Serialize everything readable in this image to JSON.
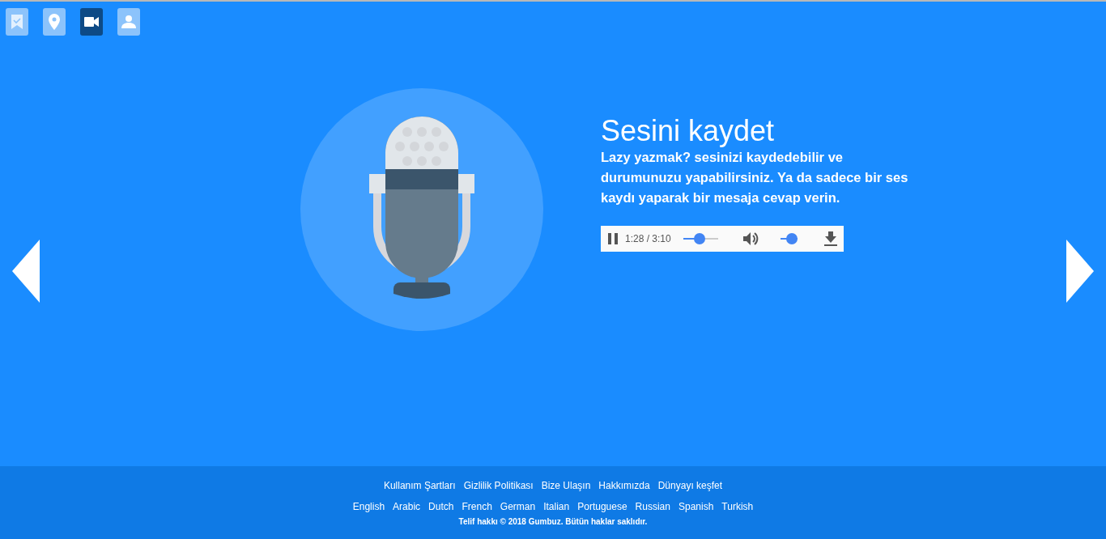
{
  "nav": [
    {
      "kind": "bookmark",
      "selected": false
    },
    {
      "kind": "pin",
      "selected": false
    },
    {
      "kind": "video",
      "selected": true
    },
    {
      "kind": "person",
      "selected": false
    }
  ],
  "slide": {
    "title": "Sesini kaydet",
    "description": "Lazy yazmak? sesinizi kaydedebilir ve durumunuzu yapabilirsiniz. Ya da sadece bir ses kaydı yaparak bir mesaja cevap verin.",
    "player": {
      "playing": true,
      "time": "1:28 / 3:10",
      "progress": {
        "level": 0.46
      },
      "volume": {
        "level": 1.0
      }
    }
  },
  "footer": {
    "links": [
      "Kullanım Şartları",
      "Gizlilik Politikası",
      "Bize Ulaşın",
      "Hakkımızda",
      "Dünyayı keşfet"
    ],
    "languages": [
      "English",
      "Arabic",
      "Dutch",
      "French",
      "German",
      "Italian",
      "Portuguese",
      "Russian",
      "Spanish",
      "Turkish"
    ],
    "copyright": "Telif hakkı © 2018 Gumbuz. Bütün haklar saklıdır."
  }
}
